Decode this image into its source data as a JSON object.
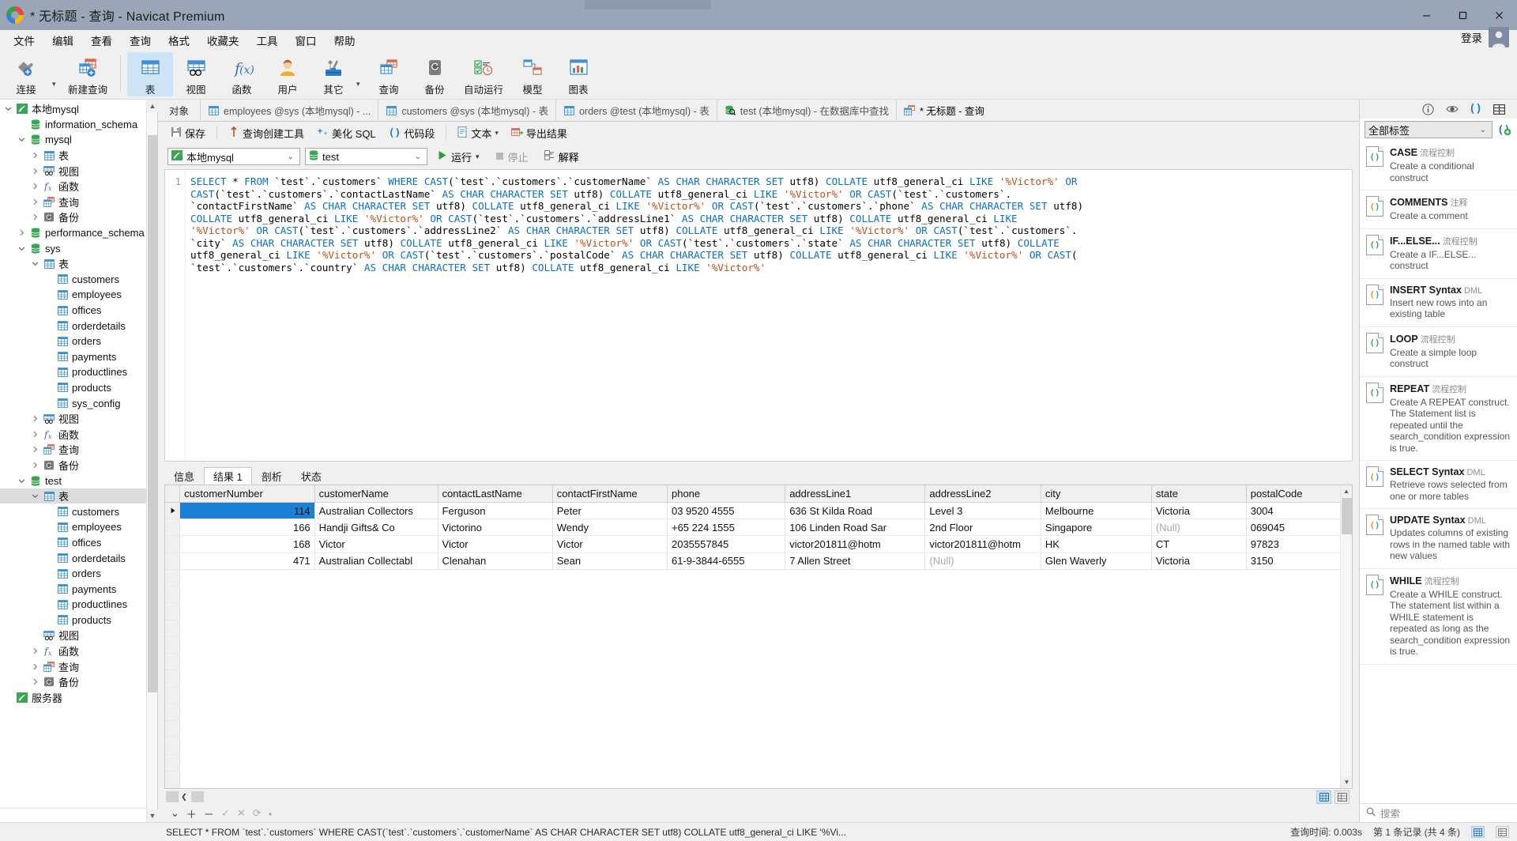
{
  "window": {
    "title": "* 无标题 - 查询 - Navicat Premium",
    "minimize": "–",
    "maximize": "▢",
    "close": "✕"
  },
  "menubar": {
    "items": [
      "文件",
      "编辑",
      "查看",
      "查询",
      "格式",
      "收藏夹",
      "工具",
      "窗口",
      "帮助"
    ],
    "login_label": "登录"
  },
  "ribbon": {
    "buttons": [
      {
        "label": "连接",
        "icon": "connection-icon",
        "has_caret": true,
        "active": false
      },
      {
        "label": "新建查询",
        "icon": "new-query-icon",
        "has_caret": false,
        "active": false
      },
      {
        "label": "表",
        "icon": "table-icon",
        "has_caret": false,
        "active": true
      },
      {
        "label": "视图",
        "icon": "view-icon",
        "has_caret": false,
        "active": false
      },
      {
        "label": "函数",
        "icon": "function-icon",
        "has_caret": false,
        "active": false
      },
      {
        "label": "用户",
        "icon": "user-icon",
        "has_caret": false,
        "active": false
      },
      {
        "label": "其它",
        "icon": "other-tools-icon",
        "has_caret": true,
        "active": false
      },
      {
        "label": "查询",
        "icon": "query-icon",
        "has_caret": false,
        "active": false
      },
      {
        "label": "备份",
        "icon": "backup-icon",
        "has_caret": false,
        "active": false
      },
      {
        "label": "自动运行",
        "icon": "automation-icon",
        "has_caret": false,
        "active": false
      },
      {
        "label": "模型",
        "icon": "model-icon",
        "has_caret": false,
        "active": false
      },
      {
        "label": "图表",
        "icon": "chart-icon",
        "has_caret": false,
        "active": false
      }
    ]
  },
  "sidebar": {
    "nodes": [
      {
        "label": "本地mysql",
        "depth": 0,
        "icon": "connection-icon",
        "twisty": "down",
        "selected": false
      },
      {
        "label": "information_schema",
        "depth": 1,
        "icon": "database-icon",
        "twisty": "none",
        "selected": false
      },
      {
        "label": "mysql",
        "depth": 1,
        "icon": "database-icon",
        "twisty": "down",
        "selected": false
      },
      {
        "label": "表",
        "depth": 2,
        "icon": "table-icon",
        "twisty": "right",
        "selected": false
      },
      {
        "label": "视图",
        "depth": 2,
        "icon": "view-icon",
        "twisty": "right",
        "selected": false
      },
      {
        "label": "函数",
        "depth": 2,
        "icon": "function-icon",
        "twisty": "right",
        "selected": false
      },
      {
        "label": "查询",
        "depth": 2,
        "icon": "query-icon",
        "twisty": "right",
        "selected": false
      },
      {
        "label": "备份",
        "depth": 2,
        "icon": "backup-icon",
        "twisty": "right",
        "selected": false
      },
      {
        "label": "performance_schema",
        "depth": 1,
        "icon": "database-icon",
        "twisty": "right",
        "selected": false
      },
      {
        "label": "sys",
        "depth": 1,
        "icon": "database-icon",
        "twisty": "down",
        "selected": false
      },
      {
        "label": "表",
        "depth": 2,
        "icon": "table-icon",
        "twisty": "down",
        "selected": false
      },
      {
        "label": "customers",
        "depth": 3,
        "icon": "table-icon",
        "twisty": "none",
        "selected": false
      },
      {
        "label": "employees",
        "depth": 3,
        "icon": "table-icon",
        "twisty": "none",
        "selected": false
      },
      {
        "label": "offices",
        "depth": 3,
        "icon": "table-icon",
        "twisty": "none",
        "selected": false
      },
      {
        "label": "orderdetails",
        "depth": 3,
        "icon": "table-icon",
        "twisty": "none",
        "selected": false
      },
      {
        "label": "orders",
        "depth": 3,
        "icon": "table-icon",
        "twisty": "none",
        "selected": false
      },
      {
        "label": "payments",
        "depth": 3,
        "icon": "table-icon",
        "twisty": "none",
        "selected": false
      },
      {
        "label": "productlines",
        "depth": 3,
        "icon": "table-icon",
        "twisty": "none",
        "selected": false
      },
      {
        "label": "products",
        "depth": 3,
        "icon": "table-icon",
        "twisty": "none",
        "selected": false
      },
      {
        "label": "sys_config",
        "depth": 3,
        "icon": "table-icon",
        "twisty": "none",
        "selected": false
      },
      {
        "label": "视图",
        "depth": 2,
        "icon": "view-icon",
        "twisty": "right",
        "selected": false
      },
      {
        "label": "函数",
        "depth": 2,
        "icon": "function-icon",
        "twisty": "right",
        "selected": false
      },
      {
        "label": "查询",
        "depth": 2,
        "icon": "query-icon",
        "twisty": "right",
        "selected": false
      },
      {
        "label": "备份",
        "depth": 2,
        "icon": "backup-icon",
        "twisty": "right",
        "selected": false
      },
      {
        "label": "test",
        "depth": 1,
        "icon": "database-icon",
        "twisty": "down",
        "selected": false
      },
      {
        "label": "表",
        "depth": 2,
        "icon": "table-icon",
        "twisty": "down",
        "selected": true
      },
      {
        "label": "customers",
        "depth": 3,
        "icon": "table-icon",
        "twisty": "none",
        "selected": false
      },
      {
        "label": "employees",
        "depth": 3,
        "icon": "table-icon",
        "twisty": "none",
        "selected": false
      },
      {
        "label": "offices",
        "depth": 3,
        "icon": "table-icon",
        "twisty": "none",
        "selected": false
      },
      {
        "label": "orderdetails",
        "depth": 3,
        "icon": "table-icon",
        "twisty": "none",
        "selected": false
      },
      {
        "label": "orders",
        "depth": 3,
        "icon": "table-icon",
        "twisty": "none",
        "selected": false
      },
      {
        "label": "payments",
        "depth": 3,
        "icon": "table-icon",
        "twisty": "none",
        "selected": false
      },
      {
        "label": "productlines",
        "depth": 3,
        "icon": "table-icon",
        "twisty": "none",
        "selected": false
      },
      {
        "label": "products",
        "depth": 3,
        "icon": "table-icon",
        "twisty": "none",
        "selected": false
      },
      {
        "label": "视图",
        "depth": 2,
        "icon": "view-icon",
        "twisty": "none",
        "selected": false
      },
      {
        "label": "函数",
        "depth": 2,
        "icon": "function-icon",
        "twisty": "right",
        "selected": false
      },
      {
        "label": "查询",
        "depth": 2,
        "icon": "query-icon",
        "twisty": "right",
        "selected": false
      },
      {
        "label": "备份",
        "depth": 2,
        "icon": "backup-icon",
        "twisty": "right",
        "selected": false
      },
      {
        "label": "服务器",
        "depth": 0,
        "icon": "connection-icon",
        "twisty": "none",
        "selected": false
      }
    ]
  },
  "tabstrip": {
    "object_tab": "对象",
    "tabs": [
      {
        "label": "employees @sys (本地mysql) - ...",
        "icon": "table-icon",
        "active": false
      },
      {
        "label": "customers @sys (本地mysql) - 表",
        "icon": "table-icon",
        "active": false
      },
      {
        "label": "orders @test (本地mysql) - 表",
        "icon": "table-icon",
        "active": false
      },
      {
        "label": "test (本地mysql) - 在数据库中查找",
        "icon": "find-db-icon",
        "active": false
      },
      {
        "label": "* 无标题 - 查询",
        "icon": "query-icon",
        "active": true
      }
    ]
  },
  "query_toolbar": {
    "save": "保存",
    "query_builder": "查询创建工具",
    "beautify_sql": "美化 SQL",
    "code_snippet": "代码段",
    "text": "文本",
    "export_result": "导出结果"
  },
  "connection_row": {
    "connection_value": "本地mysql",
    "database_value": "test",
    "run": "运行",
    "stop": "停止",
    "explain": "解释"
  },
  "editor": {
    "line_number": "1",
    "sql_lines": [
      "SELECT * FROM `test`.`customers` WHERE CAST(`test`.`customers`.`customerName` AS CHAR CHARACTER SET utf8) COLLATE utf8_general_ci LIKE '%Victor%' OR",
      "CAST(`test`.`customers`.`contactLastName` AS CHAR CHARACTER SET utf8) COLLATE utf8_general_ci LIKE '%Victor%' OR CAST(`test`.`customers`.",
      "`contactFirstName` AS CHAR CHARACTER SET utf8) COLLATE utf8_general_ci LIKE '%Victor%' OR CAST(`test`.`customers`.`phone` AS CHAR CHARACTER SET utf8)",
      "COLLATE utf8_general_ci LIKE '%Victor%' OR CAST(`test`.`customers`.`addressLine1` AS CHAR CHARACTER SET utf8) COLLATE utf8_general_ci LIKE",
      "'%Victor%' OR CAST(`test`.`customers`.`addressLine2` AS CHAR CHARACTER SET utf8) COLLATE utf8_general_ci LIKE '%Victor%' OR CAST(`test`.`customers`.",
      "`city` AS CHAR CHARACTER SET utf8) COLLATE utf8_general_ci LIKE '%Victor%' OR CAST(`test`.`customers`.`state` AS CHAR CHARACTER SET utf8) COLLATE",
      "utf8_general_ci LIKE '%Victor%' OR CAST(`test`.`customers`.`postalCode` AS CHAR CHARACTER SET utf8) COLLATE utf8_general_ci LIKE '%Victor%' OR CAST(",
      "`test`.`customers`.`country` AS CHAR CHARACTER SET utf8) COLLATE utf8_general_ci LIKE '%Victor%'"
    ]
  },
  "results": {
    "tabs": [
      {
        "label": "信息",
        "active": false
      },
      {
        "label": "结果 1",
        "active": true
      },
      {
        "label": "剖析",
        "active": false
      },
      {
        "label": "状态",
        "active": false
      }
    ],
    "columns": [
      "customerNumber",
      "customerName",
      "contactLastName",
      "contactFirstName",
      "phone",
      "addressLine1",
      "addressLine2",
      "city",
      "state",
      "postalCode"
    ],
    "rows": [
      {
        "selected": true,
        "cells": [
          "114",
          "Australian Collectors",
          "Ferguson",
          "Peter",
          "03 9520 4555",
          "636 St Kilda Road",
          "Level 3",
          "Melbourne",
          "Victoria",
          "3004"
        ]
      },
      {
        "selected": false,
        "cells": [
          "166",
          "Handji Gifts& Co",
          "Victorino",
          "Wendy",
          "+65 224 1555",
          "106 Linden Road Sar",
          "2nd Floor",
          "Singapore",
          "(Null)",
          "069045"
        ]
      },
      {
        "selected": false,
        "cells": [
          "168",
          "Victor",
          "Victor",
          "Victor",
          "2035557845",
          "victor201811@hotm",
          "victor201811@hotm",
          "HK",
          "CT",
          "97823"
        ]
      },
      {
        "selected": false,
        "cells": [
          "471",
          "Australian Collectabl",
          "Clenahan",
          "Sean",
          "61-9-3844-6555",
          "7 Allen Street",
          "(Null)",
          "Glen Waverly",
          "Victoria",
          "3150"
        ]
      }
    ],
    "record_tools": [
      "＋",
      "－",
      "✓",
      "✕",
      "⟳",
      "▪"
    ]
  },
  "right_panel": {
    "icons": [
      "info-icon",
      "preview-icon",
      "snippet-icon",
      "structure-icon"
    ],
    "filter_value": "全部标签",
    "snippets": [
      {
        "title": "CASE",
        "tag": "流程控制",
        "desc": "Create a conditional construct",
        "color": "green"
      },
      {
        "title": "COMMENTS",
        "tag": "注释",
        "desc": "Create a comment",
        "color": "orange"
      },
      {
        "title": "IF...ELSE...",
        "tag": "流程控制",
        "desc": "Create a IF...ELSE... construct",
        "color": "green"
      },
      {
        "title": "INSERT Syntax",
        "tag": "DML",
        "desc": "Insert new rows into an existing table",
        "color": "orange"
      },
      {
        "title": "LOOP",
        "tag": "流程控制",
        "desc": "Create a simple loop construct",
        "color": "green"
      },
      {
        "title": "REPEAT",
        "tag": "流程控制",
        "desc": "Create A REPEAT construct. The Statement list is repeated until the search_condition expression is true.",
        "color": "green"
      },
      {
        "title": "SELECT Syntax",
        "tag": "DML",
        "desc": "Retrieve rows selected from one or more tables",
        "color": "orange"
      },
      {
        "title": "UPDATE Syntax",
        "tag": "DML",
        "desc": "Updates columns of existing rows in the named table with new values",
        "color": "orange"
      },
      {
        "title": "WHILE",
        "tag": "流程控制",
        "desc": "Create a WHILE construct. The statement list within a WHILE statement is repeated as long as the search_condition expression is true.",
        "color": "green"
      }
    ],
    "search_placeholder": "搜索"
  },
  "statusbar": {
    "sql_preview": "SELECT * FROM `test`.`customers` WHERE CAST(`test`.`customers`.`customerName` AS CHAR CHARACTER SET utf8) COLLATE utf8_general_ci LIKE '%Vi...",
    "time": "查询时间: 0.003s",
    "rows": "第 1 条记录 (共 4 条)"
  },
  "colors": {
    "title_bar": "#9aa5b8",
    "accent": "#1b80d4",
    "ribbon_active": "#cde4f7",
    "keyword": "#0b6ecb",
    "string": "#c04f15",
    "null_text": "#a8a8a8"
  }
}
